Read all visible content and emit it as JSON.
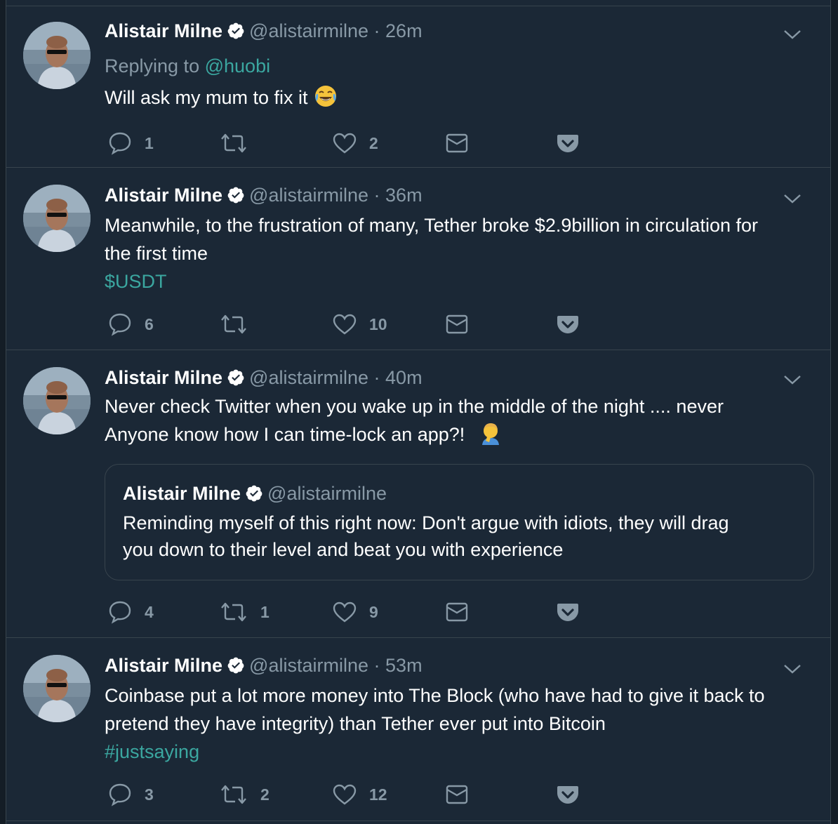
{
  "tweets": [
    {
      "name": "Alistair Milne",
      "handle": "@alistairmilne",
      "dot": "·",
      "time": "26m",
      "reply_prefix": "Replying to",
      "reply_handle": "@huobi",
      "text": "Will ask my mum to fix it",
      "emoji": "face-with-tears-of-joy-icon",
      "counts": {
        "reply": "1",
        "retweet": "",
        "like": "2"
      }
    },
    {
      "name": "Alistair Milne",
      "handle": "@alistairmilne",
      "dot": "·",
      "time": "36m",
      "text_line1": "Meanwhile, to the frustration of many, Tether broke $2.9billion in circulation for",
      "text_line2": "the first time",
      "cashtag": "$USDT",
      "counts": {
        "reply": "6",
        "retweet": "",
        "like": "10"
      }
    },
    {
      "name": "Alistair Milne",
      "handle": "@alistairmilne",
      "dot": "·",
      "time": "40m",
      "text_line1": "Never check Twitter when you wake up in the middle of the night .... never",
      "text_line2": "Anyone know how I can time-lock an app?!",
      "emoji": "man-facepalming-icon",
      "quote": {
        "name": "Alistair Milne",
        "handle": "@alistairmilne",
        "text_line1": "Reminding myself of this right now:  Don't argue with idiots, they will drag",
        "text_line2": "you down to their level and beat you with experience"
      },
      "counts": {
        "reply": "4",
        "retweet": "1",
        "like": "9"
      }
    },
    {
      "name": "Alistair Milne",
      "handle": "@alistairmilne",
      "dot": "·",
      "time": "53m",
      "text_line1": "Coinbase put a lot more money into The Block (who have had to give it back to",
      "text_line2": "pretend they have integrity) than Tether ever put into Bitcoin",
      "hashtag": "#justsaying",
      "counts": {
        "reply": "3",
        "retweet": "2",
        "like": "12"
      }
    }
  ],
  "colors": {
    "background": "#1b2836",
    "border": "#38444d",
    "secondary_text": "#8899a6",
    "link": "#3ba7a0"
  },
  "icons": [
    "reply-icon",
    "retweet-icon",
    "like-icon",
    "direct-message-icon",
    "pocket-icon",
    "chevron-down-icon",
    "verified-badge-icon"
  ]
}
